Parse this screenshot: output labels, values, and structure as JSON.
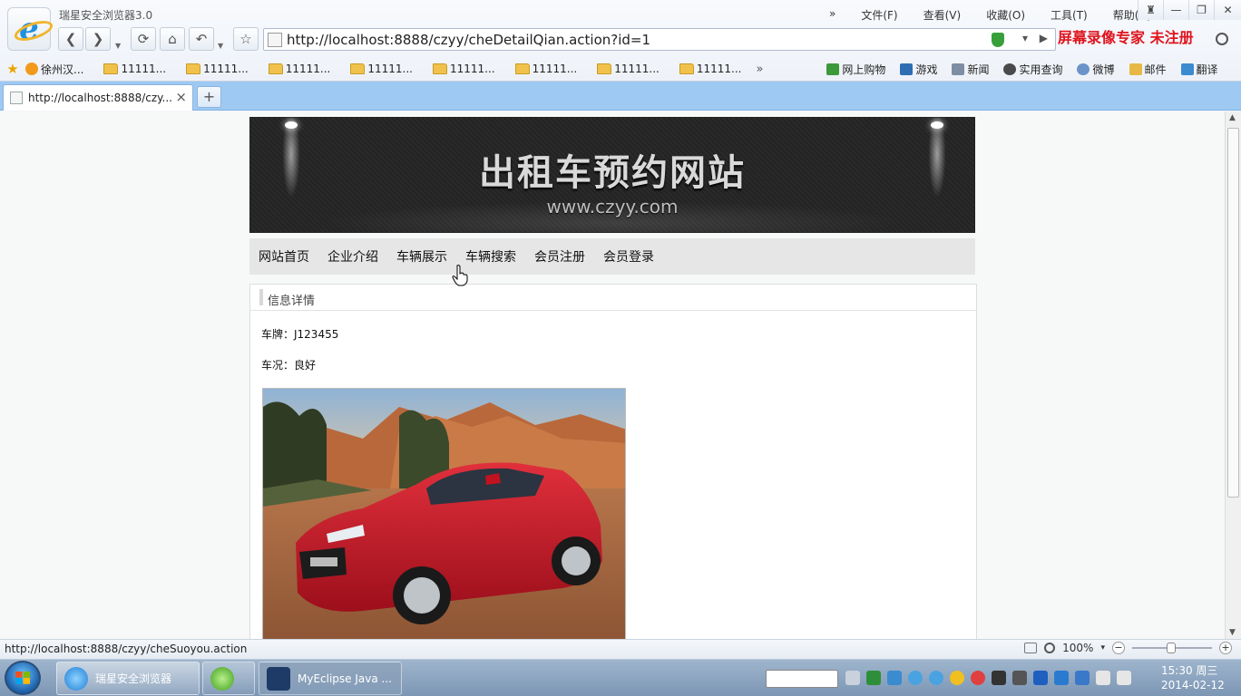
{
  "browser": {
    "app_title": "瑞星安全浏览器3.0",
    "menu": [
      "文件(F)",
      "查看(V)",
      "收藏(O)",
      "工具(T)",
      "帮助(H)"
    ],
    "menu_more": "»",
    "url": "http://localhost:8888/czyy/cheDetailQian.action?id=1",
    "watermark": "屏幕录像专家  未注册",
    "favorites": {
      "first": "徐州汉...",
      "folders": [
        "11111...",
        "11111...",
        "11111...",
        "11111...",
        "11111...",
        "11111...",
        "11111...",
        "11111..."
      ],
      "more": "»"
    },
    "tools": [
      "网上购物",
      "游戏",
      "新闻",
      "实用查询",
      "微博",
      "邮件",
      "翻译"
    ],
    "tab": {
      "title": "http://localhost:8888/czy...",
      "close": "×"
    },
    "new_tab": "+",
    "status_url": "http://localhost:8888/czyy/cheSuoyou.action",
    "zoom": "100%"
  },
  "site": {
    "banner_title": "出租车预约网站",
    "banner_sub": "www.czyy.com",
    "nav": [
      "网站首页",
      "企业介绍",
      "车辆展示",
      "车辆搜索",
      "会员注册",
      "会员登录"
    ],
    "panel_title": "信息详情",
    "plate_label": "车牌：J123455",
    "condition_label": "车况：良好"
  },
  "taskbar": {
    "tasks": [
      "瑞星安全浏览器",
      "",
      "MyEclipse Java ..."
    ],
    "time": "15:30 周三",
    "date": "2014-02-12"
  }
}
